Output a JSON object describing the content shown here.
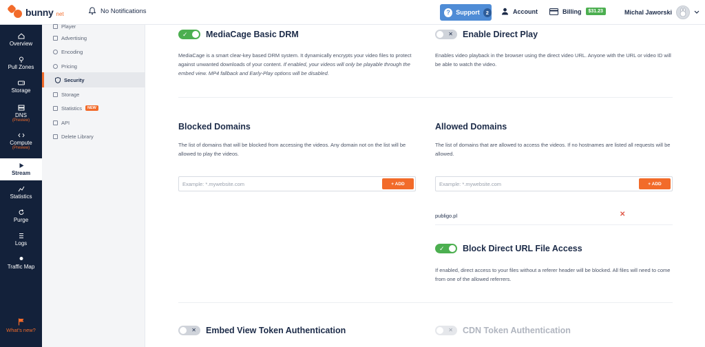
{
  "topbar": {
    "logo_text": "bunny",
    "logo_suffix": "net",
    "notifications": "No Notifications",
    "support_label": "Support",
    "support_count": "2",
    "account_label": "Account",
    "billing_label": "Billing",
    "billing_amount": "$31.23",
    "user_name": "Michal Jaworski"
  },
  "leftnav": {
    "items": [
      {
        "label": "Overview",
        "sub": "",
        "icon": "overview-icon"
      },
      {
        "label": "Pull Zones",
        "sub": "",
        "icon": "pin-icon"
      },
      {
        "label": "Storage",
        "sub": "",
        "icon": "storage-icon"
      },
      {
        "label": "DNS",
        "sub": "(Preview)",
        "icon": "dns-icon"
      },
      {
        "label": "Compute",
        "sub": "(Preview)",
        "icon": "code-icon"
      },
      {
        "label": "Stream",
        "sub": "",
        "icon": "play-icon"
      },
      {
        "label": "Statistics",
        "sub": "",
        "icon": "chart-icon"
      },
      {
        "label": "Purge",
        "sub": "",
        "icon": "refresh-icon"
      },
      {
        "label": "Logs",
        "sub": "",
        "icon": "logs-icon"
      },
      {
        "label": "Traffic Map",
        "sub": "",
        "icon": "map-pin-icon"
      }
    ],
    "whats_new": "What's new?"
  },
  "subnav": {
    "items": [
      {
        "label": "Player"
      },
      {
        "label": "Advertising"
      },
      {
        "label": "Encoding"
      },
      {
        "label": "Pricing"
      },
      {
        "label": "Security"
      },
      {
        "label": "Storage"
      },
      {
        "label": "Statistics"
      },
      {
        "label": "API"
      },
      {
        "label": "Delete Library"
      }
    ],
    "new_badge": "NEW"
  },
  "main": {
    "mediacage": {
      "title": "MediaCage Basic DRM",
      "desc": "MediaCage is a smart clear-key based DRM system. It dynamically encrypts your video files to protect against unwanted downloads of your content.",
      "desc_italic": "If enabled, your videos will only be playable through the embed view. MP4 fallback and Early-Play options will be disabled."
    },
    "direct_play": {
      "title": "Enable Direct Play",
      "desc": "Enables video playback in the browser using the direct video URL. Anyone with the URL or video ID will be able to watch the video."
    },
    "blocked": {
      "title": "Blocked Domains",
      "desc": "The list of domains that will be blocked from accessing the videos. Any domain not on the list will be allowed to play the videos.",
      "placeholder": "Example: *.mywebsite.com",
      "add_label": "+ ADD"
    },
    "allowed": {
      "title": "Allowed Domains",
      "desc": "The list of domains that are allowed to access the videos. If no hostnames are listed all requests will be allowed.",
      "placeholder": "Example: *.mywebsite.com",
      "add_label": "+ ADD",
      "domains": [
        "publigo.pl"
      ]
    },
    "block_direct": {
      "title": "Block Direct URL File Access",
      "desc": "If enabled, direct access to your files without a referer header will be blocked. All files will need to come from one of the allowed referrers."
    },
    "embed_token": {
      "title": "Embed View Token Authentication"
    },
    "cdn_token": {
      "title": "CDN Token Authentication"
    }
  },
  "colors": {
    "brand_orange": "#f26b2a",
    "nav_dark": "#13213a",
    "toggle_on": "#4caf50",
    "support_blue": "#4f8cd6"
  }
}
